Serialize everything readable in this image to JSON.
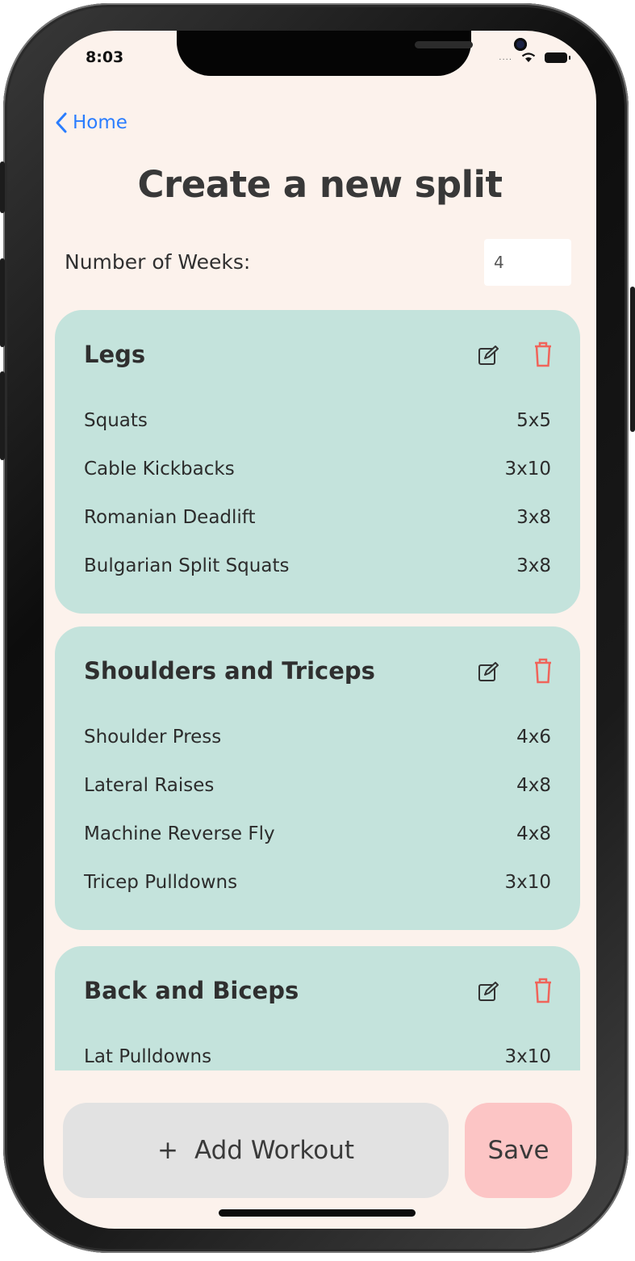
{
  "status_bar": {
    "time": "8:03",
    "signal": "...."
  },
  "nav": {
    "back_label": "Home"
  },
  "page": {
    "title": "Create a new split"
  },
  "weeks": {
    "label": "Number of Weeks:",
    "value": "4"
  },
  "workouts": [
    {
      "title": "Legs",
      "exercises": [
        {
          "name": "Squats",
          "sets": "5x5"
        },
        {
          "name": "Cable Kickbacks",
          "sets": "3x10"
        },
        {
          "name": "Romanian Deadlift",
          "sets": "3x8"
        },
        {
          "name": "Bulgarian Split Squats",
          "sets": "3x8"
        }
      ]
    },
    {
      "title": "Shoulders and Triceps",
      "exercises": [
        {
          "name": "Shoulder Press",
          "sets": "4x6"
        },
        {
          "name": "Lateral Raises",
          "sets": "4x8"
        },
        {
          "name": "Machine Reverse Fly",
          "sets": "4x8"
        },
        {
          "name": "Tricep Pulldowns",
          "sets": "3x10"
        }
      ]
    },
    {
      "title": "Back and Biceps",
      "exercises": [
        {
          "name": "Lat Pulldowns",
          "sets": "3x10"
        }
      ]
    }
  ],
  "actions": {
    "add_icon": "+",
    "add_label": "Add Workout",
    "save_label": "Save"
  },
  "colors": {
    "screen_bg": "#fcf2ec",
    "card_bg": "#c4e3dc",
    "accent_blue": "#2a7dff",
    "delete_red": "#f0645a",
    "save_bg": "#fcc5c5",
    "add_bg": "#e2e2e2"
  }
}
